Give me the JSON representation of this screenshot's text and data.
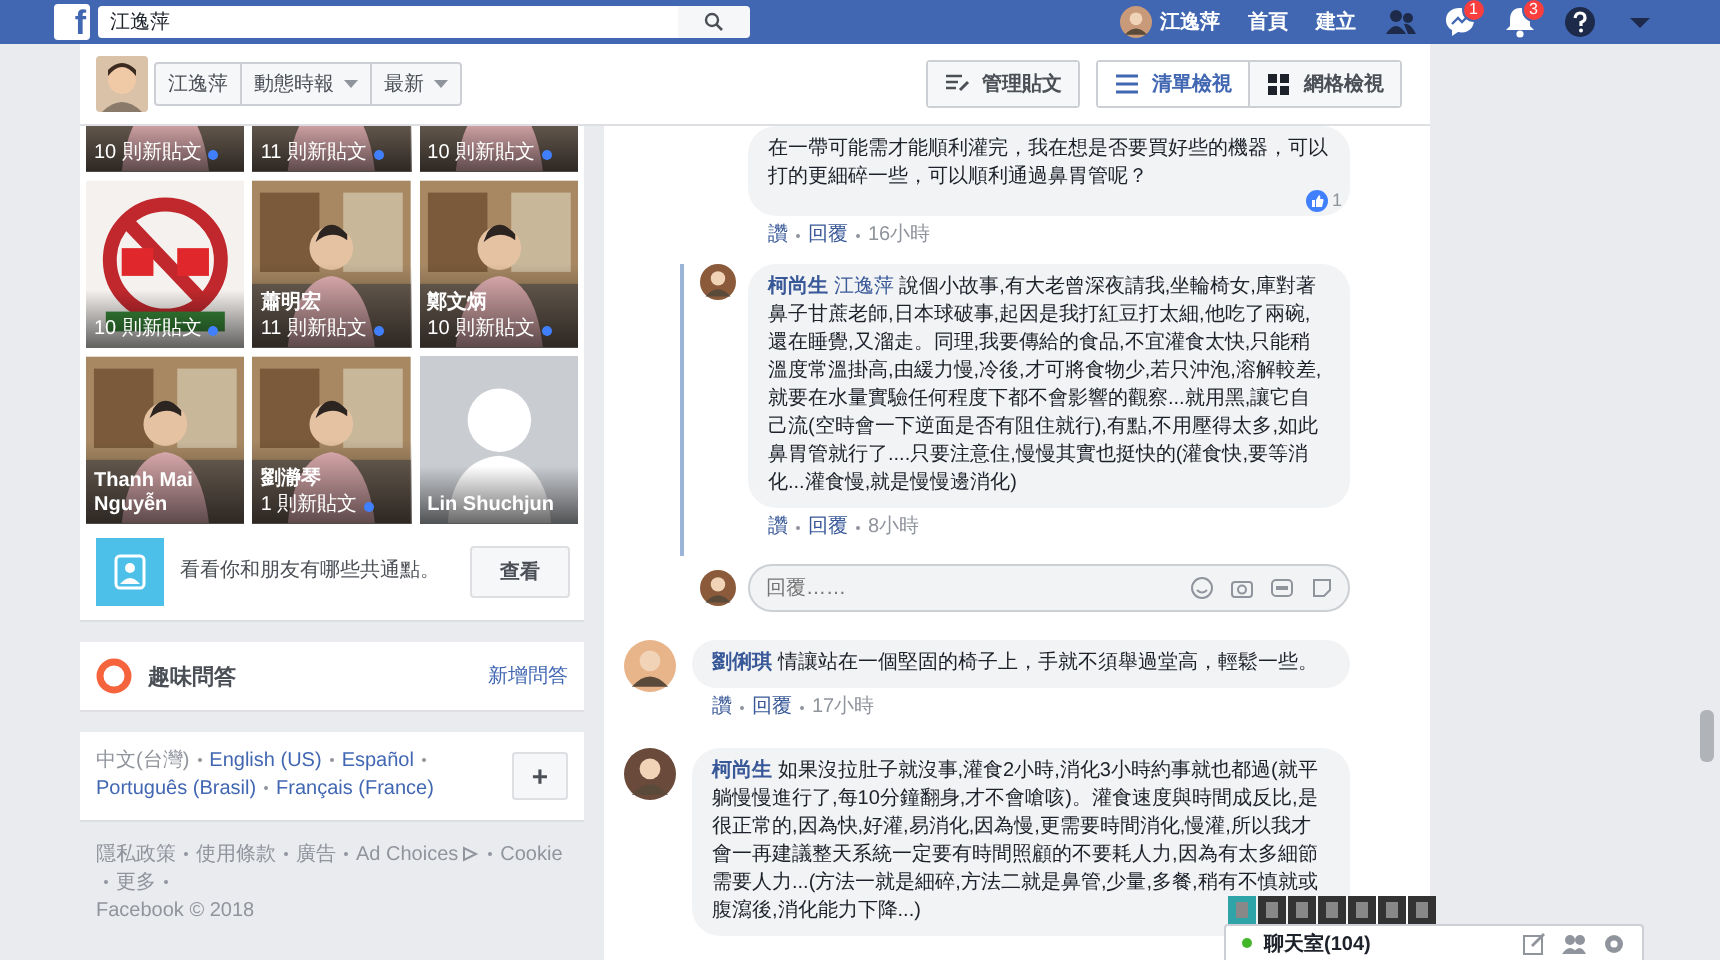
{
  "topbar": {
    "logo": "f",
    "search": {
      "value": "江逸萍"
    },
    "user": {
      "name": "江逸萍"
    },
    "links": [
      "首頁",
      "建立"
    ],
    "icons": [
      {
        "kind": "friends"
      },
      {
        "kind": "messages",
        "badge": "1"
      },
      {
        "kind": "notifications",
        "badge": "3"
      },
      {
        "kind": "help"
      },
      {
        "kind": "menu"
      }
    ]
  },
  "profile_bar": {
    "filters": [
      {
        "label": "江逸萍",
        "dropdown": false
      },
      {
        "label": "動態時報",
        "dropdown": true
      },
      {
        "label": "最新",
        "dropdown": true
      }
    ],
    "views": [
      {
        "kind": "manage",
        "label": "管理貼文",
        "selected": false
      },
      {
        "kind": "list",
        "label": "清單檢視",
        "selected": true
      },
      {
        "kind": "grid",
        "label": "網格檢視",
        "selected": false
      }
    ]
  },
  "friends": [
    {
      "posts": "10 則新貼文",
      "new": true
    },
    {
      "posts": "11 則新貼文",
      "new": true
    },
    {
      "posts": "10 則新貼文",
      "new": true
    },
    {
      "kind": "sign",
      "posts": "10 則新貼文",
      "new": true
    },
    {
      "name": "蕭明宏",
      "posts": "11 則新貼文",
      "new": true
    },
    {
      "name": "鄭文炳",
      "posts": "10 則新貼文",
      "new": true
    },
    {
      "name": "Thanh Mai Nguyễn",
      "new": false
    },
    {
      "name": "劉瀞琴",
      "posts": "1 則新貼文",
      "new": true
    },
    {
      "kind": "silhouette",
      "name": "Lin Shuchjun",
      "new": false
    }
  ],
  "common_points": {
    "text": "看看你和朋友有哪些共通點。",
    "button": "查看"
  },
  "trivia": {
    "title": "趣味問答",
    "action": "新增問答"
  },
  "languages": {
    "items": [
      "中文(台灣)",
      "English (US)",
      "Español",
      "Português (Brasil)",
      "Français (France)"
    ],
    "more": "+"
  },
  "footer": {
    "links": [
      "隱私政策",
      "使用條款",
      "廣告",
      "Ad Choices",
      "Cookie",
      "更多"
    ],
    "copyright": "Facebook © 2018"
  },
  "comments": [
    {
      "kind": "reply",
      "highlighted": false,
      "text": "在一帶可能需才能順利灌完，我在想是否要買好些的機器，可以打的更細碎一些，可以順利通過鼻胃管呢？",
      "actions": [
        "讚",
        "回覆"
      ],
      "time": "16小時",
      "likes": "1"
    },
    {
      "kind": "reply",
      "highlighted": true,
      "author": "柯尚生",
      "tag": "江逸萍",
      "text": "說個小故事,有大老曾深夜請我,坐輪椅女,庫對著鼻子甘蔗老師,日本球破事,起因是我打紅豆打太細,他吃了兩碗,還在睡覺,又溜走。同理,我要傳給的食品,不宜灌食太快,只能稍溫度常溫掛高,由緩力慢,冷後,才可將食物少,若只沖泡,溶解較差,就要在水量實驗任何程度下都不會影響的觀察...就用黑,讓它自己流(空時會一下逆面是否有阻住就行),有點,不用壓得太多,如此鼻胃管就行了....只要注意住,慢慢其實也挺快的(灌食快,要等消化...灌食慢,就是慢慢邊消化)",
      "actions": [
        "讚",
        "回覆"
      ],
      "time": "8小時"
    },
    {
      "kind": "reply_box",
      "placeholder": "回覆……"
    },
    {
      "kind": "comment",
      "author": "劉俐琪",
      "text": "情讓站在一個堅固的椅子上，手就不須舉過堂高，輕鬆一些。",
      "actions": [
        "讚",
        "回覆"
      ],
      "time": "17小時"
    },
    {
      "kind": "comment",
      "author": "柯尚生",
      "text": "如果沒拉肚子就沒事,灌食2小時,消化3小時約事就也都過(就平躺慢慢進行了,每10分鐘翻身,才不會嗆咳)。灌食速度與時間成反比,是很正常的,因為快,好灌,易消化,因為慢,更需要時間消化,慢灌,所以我才會一再建議整天系統一定要有時間照顧的不要耗人力,因為有太多細節需要人力...(方法一就是細碎,方法二就是鼻管,少量,多餐,稍有不慎就或腹瀉後,消化能力下降...)"
    }
  ],
  "chat": {
    "label": "聊天室(104)",
    "online": true
  }
}
